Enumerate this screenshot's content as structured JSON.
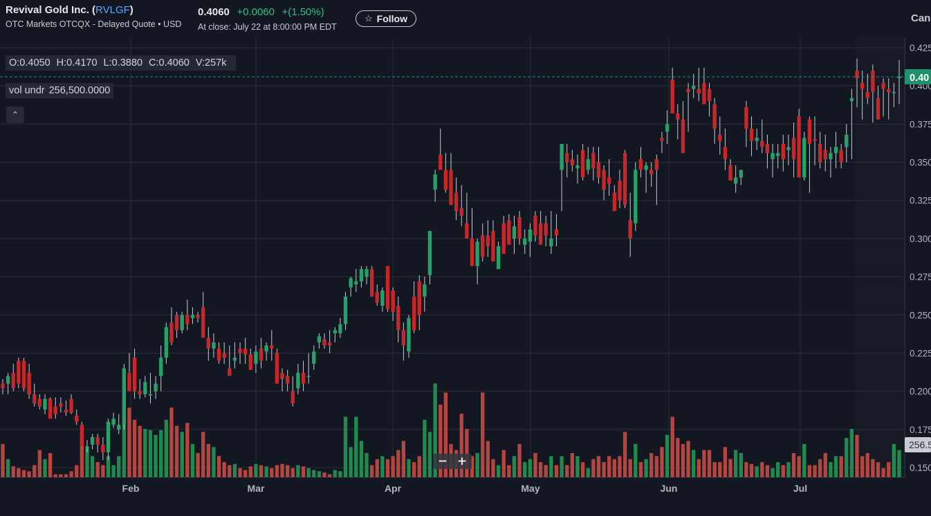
{
  "header": {
    "company": "Revival Gold Inc. (",
    "symbol": "RVLGF",
    "company_close": ")",
    "market": "OTC Markets OTCQX - Delayed Quote • USD",
    "price": "0.4060",
    "change": "+0.0060",
    "change_pct": "+(1.50%)",
    "close_time": "At close: July 22 at 8:00:00 PM EDT",
    "follow_label": "Follow",
    "cancel_label": "Can"
  },
  "legend": {
    "open": "O:0.4050",
    "high": "H:0.4170",
    "low": "L:0.3880",
    "close": "C:0.4060",
    "volume": "V:257k",
    "vol_label": "vol undr",
    "vol_value": "256,500.0000"
  },
  "controls": {
    "collapse_glyph": "⌃",
    "zoom_out": "−",
    "zoom_in": "+"
  },
  "colors": {
    "up": "#26a269",
    "down": "#c8272a",
    "vol_up": "#21884e",
    "vol_down": "#b4453f",
    "accent": "#21916b"
  },
  "chart_data": {
    "type": "candlestick",
    "y_axis": {
      "min": 0.15,
      "max": 0.425,
      "ticks": [
        "0.150",
        "0.175",
        "0.200",
        "0.225",
        "0.250",
        "0.275",
        "0.300",
        "0.325",
        "0.350",
        "0.375",
        "0.400",
        "0.425"
      ]
    },
    "x_axis": {
      "labels": [
        "Feb",
        "Mar",
        "Apr",
        "May",
        "Jun",
        "Jul"
      ]
    },
    "last_price_label": "0.40",
    "last_price": 0.406,
    "volume_label": "256.5",
    "candles": [
      [
        0.205,
        0.208,
        0.198,
        0.202,
        55
      ],
      [
        0.205,
        0.212,
        0.198,
        0.21,
        30
      ],
      [
        0.212,
        0.218,
        0.2,
        0.202,
        18
      ],
      [
        0.22,
        0.222,
        0.202,
        0.205,
        15
      ],
      [
        0.22,
        0.222,
        0.2,
        0.202,
        12
      ],
      [
        0.212,
        0.218,
        0.195,
        0.198,
        10
      ],
      [
        0.198,
        0.205,
        0.19,
        0.192,
        20
      ],
      [
        0.195,
        0.198,
        0.188,
        0.19,
        45
      ],
      [
        0.188,
        0.198,
        0.185,
        0.195,
        30
      ],
      [
        0.195,
        0.196,
        0.182,
        0.182,
        40
      ],
      [
        0.19,
        0.196,
        0.182,
        0.185,
        5
      ],
      [
        0.192,
        0.196,
        0.186,
        0.19,
        5
      ],
      [
        0.188,
        0.194,
        0.184,
        0.186,
        5
      ],
      [
        0.195,
        0.198,
        0.185,
        0.186,
        10
      ],
      [
        0.184,
        0.188,
        0.178,
        0.18,
        20
      ],
      [
        0.178,
        0.18,
        0.164,
        0.164,
        60
      ],
      [
        0.164,
        0.168,
        0.16,
        0.164,
        50
      ],
      [
        0.165,
        0.172,
        0.162,
        0.17,
        35
      ],
      [
        0.17,
        0.172,
        0.16,
        0.165,
        25
      ],
      [
        0.165,
        0.17,
        0.155,
        0.16,
        20
      ],
      [
        0.16,
        0.182,
        0.155,
        0.18,
        35
      ],
      [
        0.178,
        0.186,
        0.176,
        0.182,
        20
      ],
      [
        0.175,
        0.185,
        0.172,
        0.178,
        35
      ],
      [
        0.178,
        0.218,
        0.175,
        0.215,
        100
      ],
      [
        0.212,
        0.225,
        0.208,
        0.2,
        115
      ],
      [
        0.222,
        0.228,
        0.195,
        0.2,
        95
      ],
      [
        0.2,
        0.208,
        0.195,
        0.198,
        85
      ],
      [
        0.198,
        0.21,
        0.196,
        0.206,
        80
      ],
      [
        0.198,
        0.212,
        0.192,
        0.198,
        78
      ],
      [
        0.2,
        0.21,
        0.195,
        0.205,
        70
      ],
      [
        0.21,
        0.23,
        0.2,
        0.222,
        78
      ],
      [
        0.222,
        0.245,
        0.218,
        0.242,
        95
      ],
      [
        0.245,
        0.255,
        0.23,
        0.232,
        115
      ],
      [
        0.25,
        0.252,
        0.235,
        0.24,
        85
      ],
      [
        0.24,
        0.252,
        0.238,
        0.25,
        75
      ],
      [
        0.25,
        0.26,
        0.24,
        0.244,
        90
      ],
      [
        0.248,
        0.255,
        0.244,
        0.25,
        55
      ],
      [
        0.25,
        0.252,
        0.245,
        0.248,
        40
      ],
      [
        0.255,
        0.265,
        0.235,
        0.235,
        75
      ],
      [
        0.235,
        0.242,
        0.22,
        0.228,
        55
      ],
      [
        0.228,
        0.238,
        0.222,
        0.232,
        50
      ],
      [
        0.228,
        0.232,
        0.218,
        0.22,
        35
      ],
      [
        0.225,
        0.232,
        0.218,
        0.222,
        25
      ],
      [
        0.215,
        0.23,
        0.21,
        0.21,
        20
      ],
      [
        0.22,
        0.232,
        0.215,
        0.222,
        22
      ],
      [
        0.228,
        0.232,
        0.218,
        0.225,
        15
      ],
      [
        0.228,
        0.235,
        0.218,
        0.224,
        12
      ],
      [
        0.224,
        0.228,
        0.214,
        0.214,
        18
      ],
      [
        0.218,
        0.23,
        0.212,
        0.226,
        22
      ],
      [
        0.228,
        0.235,
        0.215,
        0.22,
        20
      ],
      [
        0.226,
        0.232,
        0.22,
        0.23,
        18
      ],
      [
        0.23,
        0.24,
        0.22,
        0.228,
        15
      ],
      [
        0.225,
        0.228,
        0.205,
        0.205,
        20
      ],
      [
        0.212,
        0.215,
        0.2,
        0.208,
        22
      ],
      [
        0.21,
        0.214,
        0.2,
        0.205,
        20
      ],
      [
        0.2,
        0.21,
        0.19,
        0.192,
        15
      ],
      [
        0.202,
        0.218,
        0.198,
        0.212,
        20
      ],
      [
        0.212,
        0.22,
        0.2,
        0.205,
        18
      ],
      [
        0.21,
        0.225,
        0.205,
        0.21,
        15
      ],
      [
        0.218,
        0.23,
        0.214,
        0.226,
        12
      ],
      [
        0.232,
        0.238,
        0.228,
        0.236,
        10
      ],
      [
        0.234,
        0.238,
        0.228,
        0.23,
        8
      ],
      [
        0.232,
        0.24,
        0.225,
        0.23,
        5
      ],
      [
        0.238,
        0.242,
        0.232,
        0.24,
        12
      ],
      [
        0.238,
        0.248,
        0.235,
        0.244,
        10
      ],
      [
        0.244,
        0.265,
        0.24,
        0.262,
        100
      ],
      [
        0.268,
        0.275,
        0.262,
        0.274,
        50
      ],
      [
        0.27,
        0.28,
        0.265,
        0.272,
        100
      ],
      [
        0.272,
        0.282,
        0.268,
        0.28,
        60
      ],
      [
        0.275,
        0.282,
        0.27,
        0.28,
        40
      ],
      [
        0.28,
        0.282,
        0.262,
        0.262,
        20
      ],
      [
        0.265,
        0.27,
        0.256,
        0.258,
        30
      ],
      [
        0.256,
        0.268,
        0.252,
        0.266,
        35
      ],
      [
        0.282,
        0.282,
        0.252,
        0.254,
        30
      ],
      [
        0.266,
        0.268,
        0.246,
        0.252,
        35
      ],
      [
        0.256,
        0.262,
        0.232,
        0.24,
        45
      ],
      [
        0.24,
        0.245,
        0.22,
        0.23,
        60
      ],
      [
        0.226,
        0.25,
        0.222,
        0.248,
        30
      ],
      [
        0.262,
        0.272,
        0.238,
        0.24,
        25
      ],
      [
        0.272,
        0.276,
        0.24,
        0.25,
        35
      ],
      [
        0.262,
        0.275,
        0.252,
        0.27,
        95
      ],
      [
        0.276,
        0.305,
        0.27,
        0.305,
        75
      ],
      [
        0.332,
        0.345,
        0.324,
        0.342,
        155
      ],
      [
        0.355,
        0.372,
        0.347,
        0.345,
        120
      ],
      [
        0.345,
        0.356,
        0.33,
        0.332,
        140
      ],
      [
        0.345,
        0.356,
        0.322,
        0.322,
        55
      ],
      [
        0.33,
        0.34,
        0.312,
        0.318,
        45
      ],
      [
        0.32,
        0.335,
        0.308,
        0.315,
        105
      ],
      [
        0.31,
        0.33,
        0.3,
        0.3,
        80
      ],
      [
        0.3,
        0.32,
        0.282,
        0.282,
        35
      ],
      [
        0.282,
        0.3,
        0.27,
        0.298,
        40
      ],
      [
        0.302,
        0.31,
        0.285,
        0.288,
        140
      ],
      [
        0.302,
        0.312,
        0.288,
        0.295,
        60
      ],
      [
        0.305,
        0.312,
        0.285,
        0.285,
        30
      ],
      [
        0.28,
        0.298,
        0.28,
        0.295,
        20
      ],
      [
        0.31,
        0.315,
        0.29,
        0.29,
        45
      ],
      [
        0.312,
        0.316,
        0.296,
        0.296,
        20
      ],
      [
        0.3,
        0.315,
        0.29,
        0.308,
        35
      ],
      [
        0.314,
        0.318,
        0.296,
        0.3,
        55
      ],
      [
        0.296,
        0.306,
        0.29,
        0.3,
        25
      ],
      [
        0.298,
        0.31,
        0.288,
        0.306,
        30
      ],
      [
        0.315,
        0.318,
        0.298,
        0.302,
        40
      ],
      [
        0.31,
        0.318,
        0.296,
        0.296,
        25
      ],
      [
        0.31,
        0.315,
        0.295,
        0.302,
        20
      ],
      [
        0.295,
        0.318,
        0.29,
        0.3,
        35
      ],
      [
        0.306,
        0.316,
        0.295,
        0.302,
        20
      ],
      [
        0.345,
        0.362,
        0.318,
        0.362,
        35
      ],
      [
        0.356,
        0.362,
        0.34,
        0.35,
        20
      ],
      [
        0.352,
        0.358,
        0.344,
        0.348,
        40
      ],
      [
        0.346,
        0.355,
        0.336,
        0.348,
        35
      ],
      [
        0.358,
        0.362,
        0.338,
        0.34,
        25
      ],
      [
        0.345,
        0.36,
        0.342,
        0.352,
        15
      ],
      [
        0.356,
        0.36,
        0.338,
        0.346,
        30
      ],
      [
        0.35,
        0.36,
        0.336,
        0.34,
        35
      ],
      [
        0.345,
        0.348,
        0.325,
        0.332,
        25
      ],
      [
        0.34,
        0.352,
        0.328,
        0.336,
        35
      ],
      [
        0.33,
        0.335,
        0.318,
        0.318,
        30
      ],
      [
        0.338,
        0.345,
        0.32,
        0.325,
        35
      ],
      [
        0.356,
        0.358,
        0.32,
        0.322,
        75
      ],
      [
        0.312,
        0.33,
        0.288,
        0.3,
        30
      ],
      [
        0.31,
        0.35,
        0.305,
        0.345,
        55
      ],
      [
        0.352,
        0.36,
        0.34,
        0.345,
        25
      ],
      [
        0.345,
        0.35,
        0.33,
        0.348,
        30
      ],
      [
        0.345,
        0.35,
        0.334,
        0.342,
        40
      ],
      [
        0.352,
        0.355,
        0.322,
        0.345,
        35
      ],
      [
        0.366,
        0.37,
        0.356,
        0.364,
        50
      ],
      [
        0.37,
        0.384,
        0.362,
        0.375,
        70
      ],
      [
        0.404,
        0.412,
        0.382,
        0.382,
        100
      ],
      [
        0.382,
        0.388,
        0.365,
        0.378,
        65
      ],
      [
        0.378,
        0.39,
        0.356,
        0.356,
        55
      ],
      [
        0.398,
        0.402,
        0.37,
        0.396,
        60
      ],
      [
        0.398,
        0.408,
        0.392,
        0.4,
        45
      ],
      [
        0.398,
        0.412,
        0.39,
        0.395,
        30
      ],
      [
        0.402,
        0.412,
        0.388,
        0.388,
        45
      ],
      [
        0.398,
        0.402,
        0.38,
        0.39,
        45
      ],
      [
        0.388,
        0.392,
        0.362,
        0.372,
        25
      ],
      [
        0.368,
        0.38,
        0.355,
        0.364,
        25
      ],
      [
        0.36,
        0.372,
        0.345,
        0.352,
        50
      ],
      [
        0.348,
        0.352,
        0.338,
        0.338,
        30
      ],
      [
        0.336,
        0.348,
        0.33,
        0.34,
        45
      ],
      [
        0.34,
        0.345,
        0.335,
        0.345,
        40
      ],
      [
        0.386,
        0.39,
        0.36,
        0.372,
        25
      ],
      [
        0.372,
        0.38,
        0.354,
        0.364,
        22
      ],
      [
        0.364,
        0.372,
        0.358,
        0.366,
        18
      ],
      [
        0.364,
        0.378,
        0.356,
        0.36,
        25
      ],
      [
        0.362,
        0.368,
        0.346,
        0.356,
        20
      ],
      [
        0.352,
        0.362,
        0.34,
        0.356,
        15
      ],
      [
        0.354,
        0.362,
        0.346,
        0.356,
        25
      ],
      [
        0.362,
        0.368,
        0.344,
        0.352,
        20
      ],
      [
        0.358,
        0.368,
        0.348,
        0.36,
        25
      ],
      [
        0.366,
        0.376,
        0.34,
        0.352,
        40
      ],
      [
        0.38,
        0.385,
        0.35,
        0.34,
        35
      ],
      [
        0.34,
        0.37,
        0.338,
        0.366,
        55
      ],
      [
        0.378,
        0.38,
        0.33,
        0.362,
        20
      ],
      [
        0.365,
        0.38,
        0.348,
        0.364,
        20
      ],
      [
        0.362,
        0.37,
        0.346,
        0.35,
        30
      ],
      [
        0.358,
        0.368,
        0.344,
        0.352,
        40
      ],
      [
        0.352,
        0.36,
        0.34,
        0.356,
        25
      ],
      [
        0.356,
        0.37,
        0.346,
        0.36,
        35
      ],
      [
        0.358,
        0.362,
        0.346,
        0.35,
        35
      ],
      [
        0.36,
        0.375,
        0.35,
        0.368,
        65
      ],
      [
        0.39,
        0.398,
        0.352,
        0.392,
        80
      ],
      [
        0.41,
        0.418,
        0.386,
        0.405,
        70
      ],
      [
        0.402,
        0.41,
        0.378,
        0.398,
        35
      ],
      [
        0.396,
        0.408,
        0.388,
        0.392,
        40
      ],
      [
        0.41,
        0.414,
        0.376,
        0.396,
        30
      ],
      [
        0.392,
        0.4,
        0.378,
        0.378,
        25
      ],
      [
        0.402,
        0.405,
        0.38,
        0.398,
        15
      ],
      [
        0.398,
        0.405,
        0.378,
        0.396,
        25
      ],
      [
        0.396,
        0.402,
        0.386,
        0.396,
        55
      ],
      [
        0.405,
        0.417,
        0.388,
        0.406,
        45
      ]
    ]
  }
}
